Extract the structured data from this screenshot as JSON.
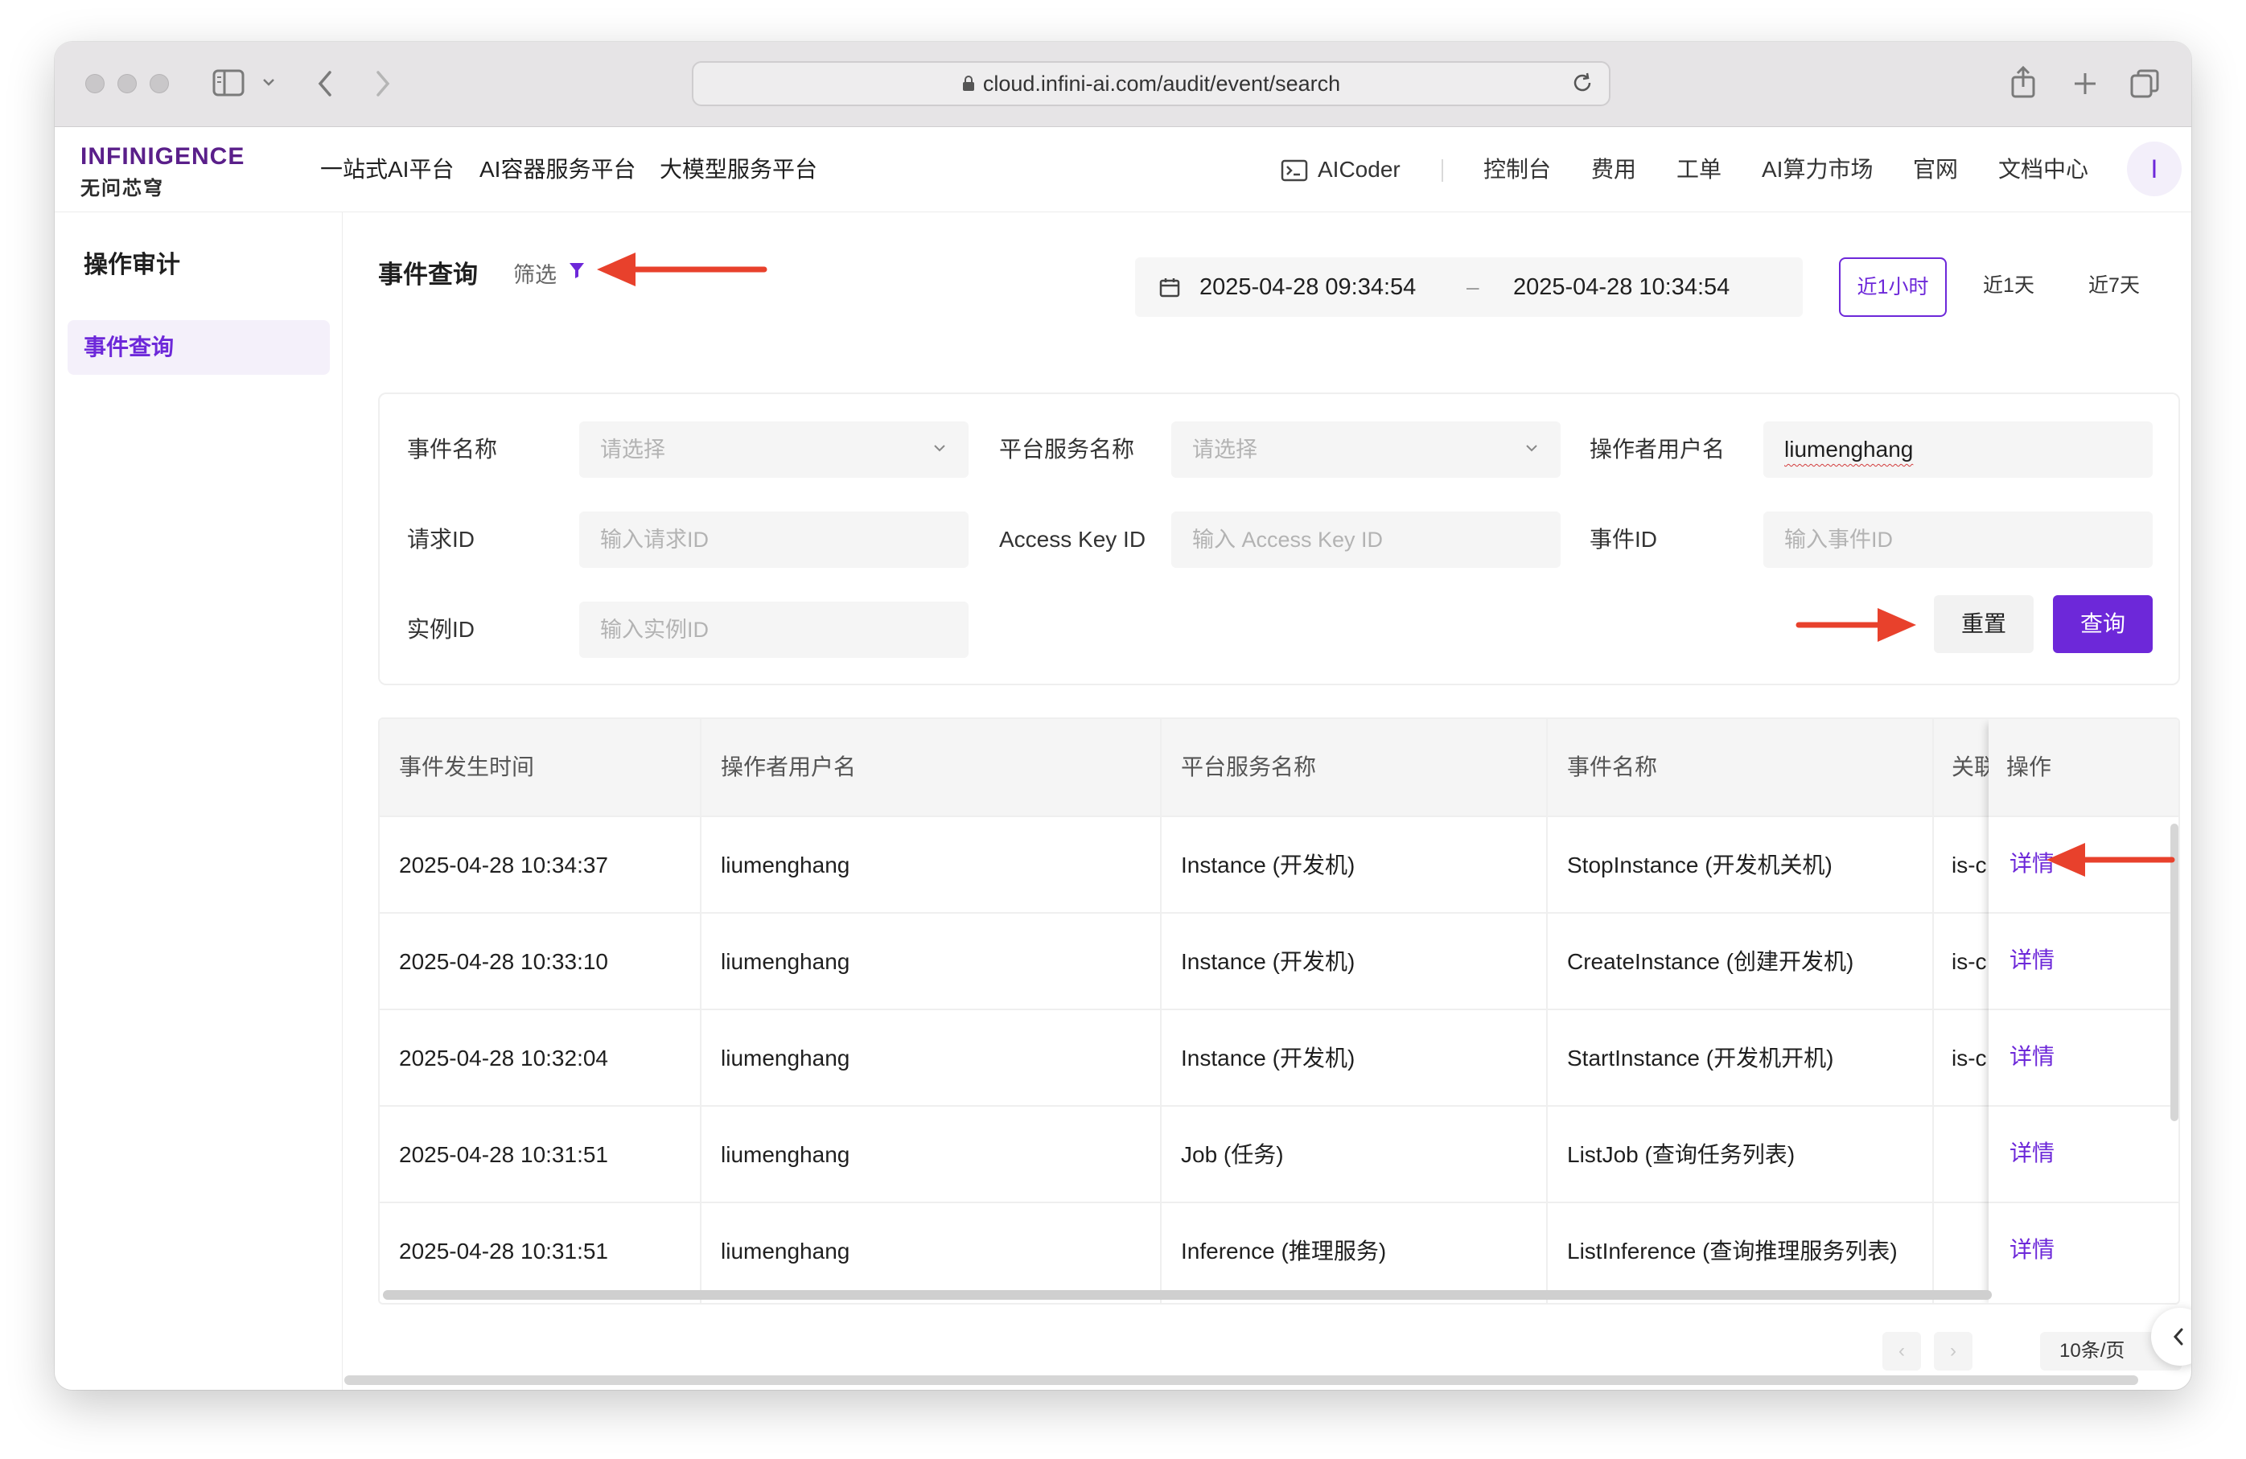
{
  "browser": {
    "url": "cloud.infini-ai.com/audit/event/search"
  },
  "brand": {
    "logo_main": "INFINIGENCE",
    "logo_sub": "无问芯穹",
    "accent": "#6d28d9"
  },
  "topnav": {
    "items": [
      "一站式AI平台",
      "AI容器服务平台",
      "大模型服务平台"
    ]
  },
  "rightnav": {
    "aicoder": "AICoder",
    "items": [
      "控制台",
      "费用",
      "工单",
      "AI算力市场",
      "官网",
      "文档中心"
    ],
    "avatar": "I"
  },
  "sidebar": {
    "title": "操作审计",
    "items": [
      {
        "label": "事件查询",
        "active": true
      }
    ]
  },
  "page": {
    "title": "事件查询",
    "filter_label": "筛选"
  },
  "daterange": {
    "start": "2025-04-28 09:34:54",
    "separator": "–",
    "end": "2025-04-28 10:34:54",
    "ranges": [
      "近1小时",
      "近1天",
      "近7天"
    ],
    "active_range": "近1小时"
  },
  "filters": {
    "event_name": {
      "label": "事件名称",
      "placeholder": "请选择"
    },
    "service_name": {
      "label": "平台服务名称",
      "placeholder": "请选择"
    },
    "operator": {
      "label": "操作者用户名",
      "value": "liumenghang"
    },
    "request_id": {
      "label": "请求ID",
      "placeholder": "输入请求ID"
    },
    "access_key": {
      "label": "Access Key ID",
      "placeholder": "输入 Access Key ID"
    },
    "event_id": {
      "label": "事件ID",
      "placeholder": "输入事件ID"
    },
    "instance_id": {
      "label": "实例ID",
      "placeholder": "输入实例ID"
    },
    "reset_label": "重置",
    "query_label": "查询"
  },
  "table": {
    "columns": [
      "事件发生时间",
      "操作者用户名",
      "平台服务名称",
      "事件名称",
      "关联",
      "操作"
    ],
    "rows": [
      {
        "time": "2025-04-28 10:34:37",
        "user": "liumenghang",
        "service": "Instance (开发机)",
        "event": "StopInstance (开发机关机)",
        "rel": "is-c",
        "action": "详情"
      },
      {
        "time": "2025-04-28 10:33:10",
        "user": "liumenghang",
        "service": "Instance (开发机)",
        "event": "CreateInstance (创建开发机)",
        "rel": "is-c",
        "action": "详情"
      },
      {
        "time": "2025-04-28 10:32:04",
        "user": "liumenghang",
        "service": "Instance (开发机)",
        "event": "StartInstance (开发机开机)",
        "rel": "is-c",
        "action": "详情"
      },
      {
        "time": "2025-04-28 10:31:51",
        "user": "liumenghang",
        "service": "Job (任务)",
        "event": "ListJob (查询任务列表)",
        "rel": "",
        "action": "详情"
      },
      {
        "time": "2025-04-28 10:31:51",
        "user": "liumenghang",
        "service": "Inference (推理服务)",
        "event": "ListInference (查询推理服务列表)",
        "rel": "",
        "action": "详情"
      }
    ]
  },
  "pagination": {
    "prev": "‹",
    "next": "›",
    "page_size": "10条/页"
  },
  "annotations": {
    "arrow_color": "#e8412c"
  }
}
